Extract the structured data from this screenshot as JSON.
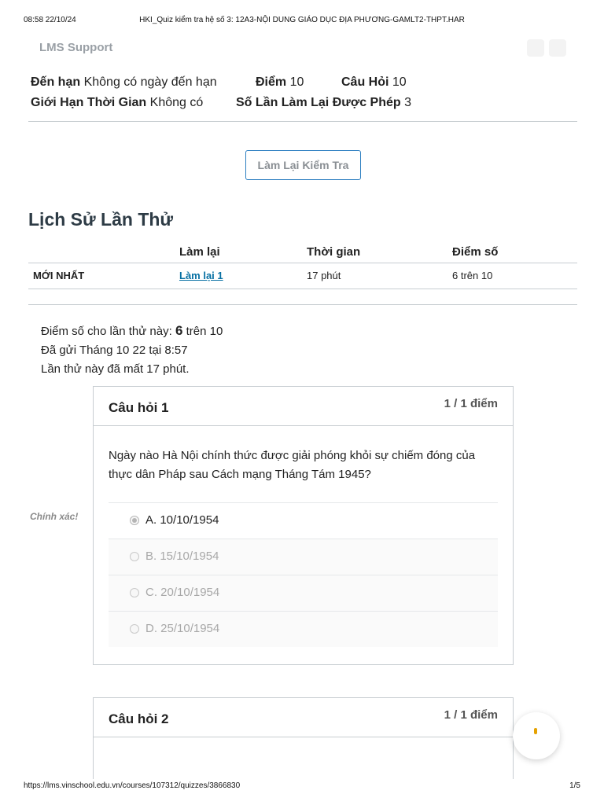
{
  "print_header": {
    "timestamp": "08:58 22/10/24",
    "document_title": "HKI_Quiz kiểm tra hệ số 3: 12A3-NỘI DUNG GIÁO DỤC ĐỊA PHƯƠNG-GAMLT2-THPT.HAR"
  },
  "app": {
    "name": "LMS Support"
  },
  "quiz_meta": {
    "due_label": "Đến hạn",
    "due_value": "Không có ngày đến hạn",
    "points_label": "Điểm",
    "points_value": "10",
    "questions_label": "Câu Hỏi",
    "questions_value": "10",
    "time_limit_label": "Giới Hạn Thời Gian",
    "time_limit_value": "Không có",
    "attempts_label": "Số Lần Làm Lại Được Phép",
    "attempts_value": "3"
  },
  "retake_button": "Làm Lại Kiểm Tra",
  "history": {
    "title": "Lịch Sử Lần Thử",
    "headers": {
      "attempt": "Làm lại",
      "time": "Thời gian",
      "score": "Điểm số"
    },
    "rows": [
      {
        "label": "MỚI NHẤT",
        "attempt": "Làm lại 1",
        "time": "17 phút",
        "score": "6 trên 10"
      }
    ]
  },
  "summary": {
    "score_prefix": "Điểm số cho lần thử này:",
    "score_value": "6",
    "score_suffix": "trên 10",
    "submitted": "Đã gửi Tháng 10 22 tại 8:57",
    "duration": "Lần thử này đã mất 17 phút."
  },
  "correct_flag": "Chính xác!",
  "questions": [
    {
      "title": "Câu hỏi 1",
      "points": "1 / 1 điểm",
      "text": "Ngày nào Hà Nội chính thức được giải phóng khỏi sự chiếm đóng của thực dân Pháp sau Cách mạng Tháng Tám 1945?",
      "answers": [
        "A. 10/10/1954",
        "B. 15/10/1954",
        "C. 20/10/1954",
        "D. 25/10/1954"
      ],
      "selected_index": 0
    },
    {
      "title": "Câu hỏi 2",
      "points": "1 / 1 điểm"
    }
  ],
  "print_footer": {
    "url": "https://lms.vinschool.edu.vn/courses/107312/quizzes/3866830",
    "page": "1/5"
  },
  "colors": {
    "link": "#0770a3",
    "button_border": "#2d7fc1",
    "rule": "#c7cdd1",
    "accent_orange": "#e5a100"
  }
}
